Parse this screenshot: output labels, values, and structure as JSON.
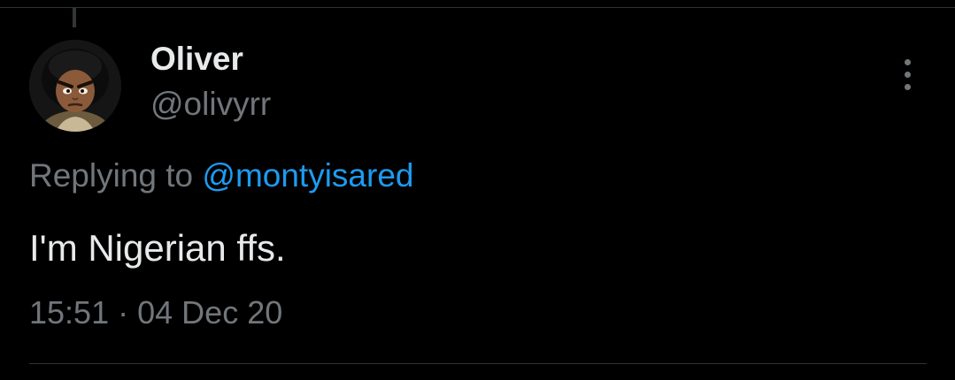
{
  "tweet": {
    "author": {
      "display_name": "Oliver",
      "handle": "@olivyrr",
      "avatar_icon": "cartoon-avatar-icon"
    },
    "replying_to": {
      "prefix": "Replying to",
      "mention": "@montyisared"
    },
    "text": "I'm Nigerian ffs.",
    "time": "15:51",
    "separator": "·",
    "date": "04 Dec 20",
    "more_icon": "more-vertical-icon"
  },
  "colors": {
    "background": "#000000",
    "primary_text": "#e7e9ea",
    "secondary_text": "#71767b",
    "link": "#1d9bf0",
    "divider": "#2f3336"
  }
}
